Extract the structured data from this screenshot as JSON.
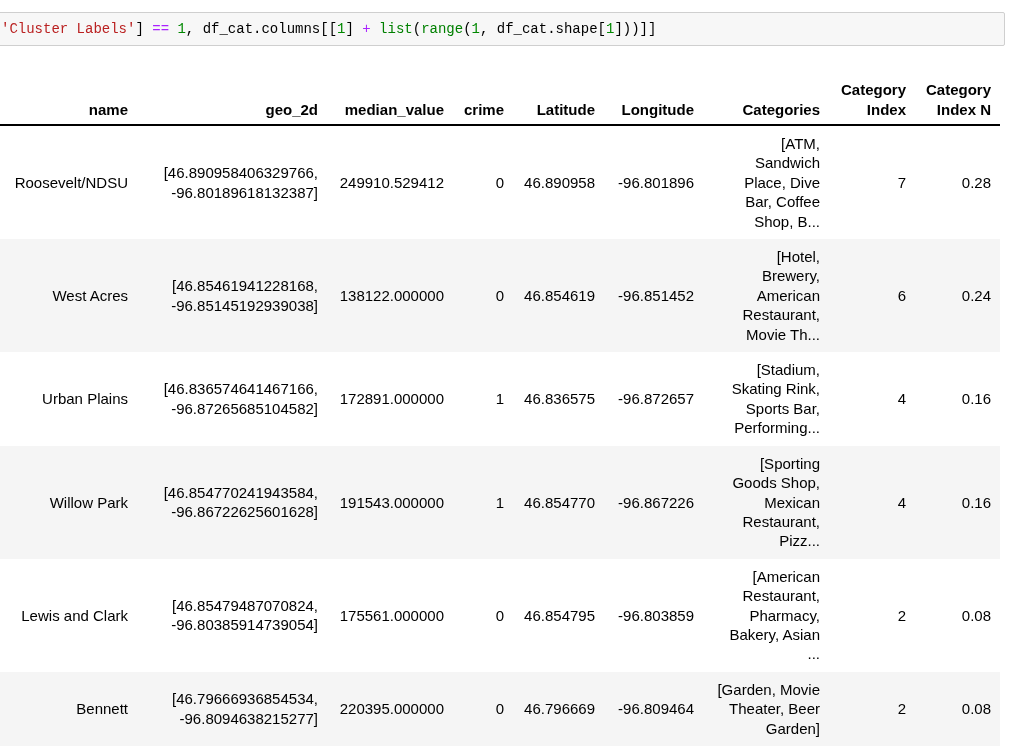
{
  "code_cell": {
    "tokens": [
      {
        "kind": "string",
        "text": "'Cluster Labels'"
      },
      {
        "kind": "plain",
        "text": "]"
      },
      {
        "kind": "operator",
        "text": " == "
      },
      {
        "kind": "number",
        "text": "1"
      },
      {
        "kind": "plain",
        "text": ", df_cat.columns[["
      },
      {
        "kind": "number",
        "text": "1"
      },
      {
        "kind": "plain",
        "text": "]"
      },
      {
        "kind": "operator",
        "text": " + "
      },
      {
        "kind": "builtin",
        "text": "list"
      },
      {
        "kind": "plain",
        "text": "("
      },
      {
        "kind": "builtin",
        "text": "range"
      },
      {
        "kind": "plain",
        "text": "("
      },
      {
        "kind": "number",
        "text": "1"
      },
      {
        "kind": "plain",
        "text": ", df_cat.shape["
      },
      {
        "kind": "number",
        "text": "1"
      },
      {
        "kind": "plain",
        "text": "]))]]"
      }
    ]
  },
  "table": {
    "columns": [
      "name",
      "geo_2d",
      "median_value",
      "crime",
      "Latitude",
      "Longitude",
      "Categories",
      "Category Index",
      "Category Index N"
    ],
    "rows": [
      [
        "Roosevelt/NDSU",
        "[46.890958406329766, -96.80189618132387]",
        "249910.529412",
        "0",
        "46.890958",
        "-96.801896",
        "[ATM, Sandwich Place, Dive Bar, Coffee Shop, B...",
        "7",
        "0.28"
      ],
      [
        "West Acres",
        "[46.85461941228168, -96.85145192939038]",
        "138122.000000",
        "0",
        "46.854619",
        "-96.851452",
        "[Hotel, Brewery, American Restaurant, Movie Th...",
        "6",
        "0.24"
      ],
      [
        "Urban Plains",
        "[46.836574641467166, -96.87265685104582]",
        "172891.000000",
        "1",
        "46.836575",
        "-96.872657",
        "[Stadium, Skating Rink, Sports Bar, Performing...",
        "4",
        "0.16"
      ],
      [
        "Willow Park",
        "[46.854770241943584, -96.86722625601628]",
        "191543.000000",
        "1",
        "46.854770",
        "-96.867226",
        "[Sporting Goods Shop, Mexican Restaurant, Pizz...",
        "4",
        "0.16"
      ],
      [
        "Lewis and Clark",
        "[46.85479487070824, -96.80385914739054]",
        "175561.000000",
        "0",
        "46.854795",
        "-96.803859",
        "[American Restaurant, Pharmacy, Bakery, Asian ...",
        "2",
        "0.08"
      ],
      [
        "Bennett",
        "[46.79666936854534, -96.8094638215277]",
        "220395.000000",
        "0",
        "46.796669",
        "-96.809464",
        "[Garden, Movie Theater, Beer Garden]",
        "2",
        "0.08"
      ]
    ]
  }
}
